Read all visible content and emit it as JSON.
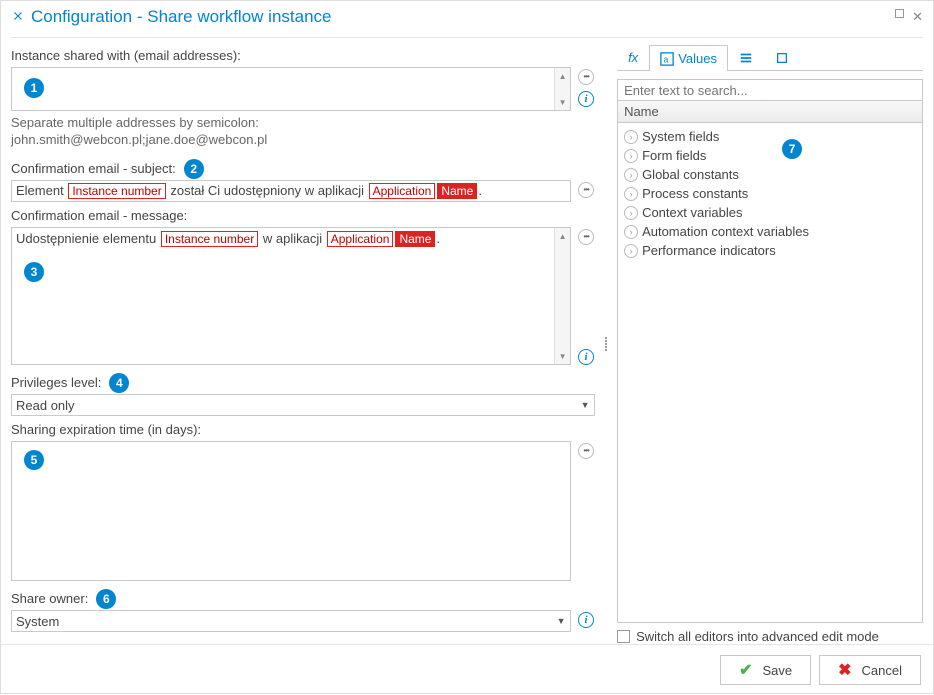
{
  "title": "Configuration - Share workflow instance",
  "left": {
    "shared_with_label": "Instance shared with (email addresses):",
    "shared_with_hint": "Separate multiple addresses by semicolon:",
    "shared_with_example": "john.smith@webcon.pl;jane.doe@webcon.pl",
    "subject_label": "Confirmation email - subject:",
    "subject_parts": {
      "t1": "Element",
      "tok1": "Instance number",
      "t2": "został Ci udostępniony w aplikacji",
      "tok2a": "Application",
      "tok2b": "Name",
      "t3": "."
    },
    "message_label": "Confirmation email - message:",
    "message_parts": {
      "t1": "Udostępnienie elementu",
      "tok1": "Instance number",
      "t2": "w aplikacji",
      "tok2a": "Application",
      "tok2b": "Name",
      "t3": "."
    },
    "privileges_label": "Privileges level:",
    "privileges_value": "Read only",
    "expiration_label": "Sharing expiration time (in days):",
    "owner_label": "Share owner:",
    "owner_value": "System"
  },
  "right": {
    "tabs": {
      "fx": "fx",
      "values": "Values"
    },
    "search_placeholder": "Enter text to search...",
    "tree_header": "Name",
    "tree_items": [
      "System fields",
      "Form fields",
      "Global constants",
      "Process constants",
      "Context variables",
      "Automation context variables",
      "Performance indicators"
    ],
    "advanced_label": "Switch all editors into advanced edit mode"
  },
  "footer": {
    "save": "Save",
    "cancel": "Cancel"
  },
  "annotations": {
    "a1": "1",
    "a2": "2",
    "a3": "3",
    "a4": "4",
    "a5": "5",
    "a6": "6",
    "a7": "7"
  }
}
